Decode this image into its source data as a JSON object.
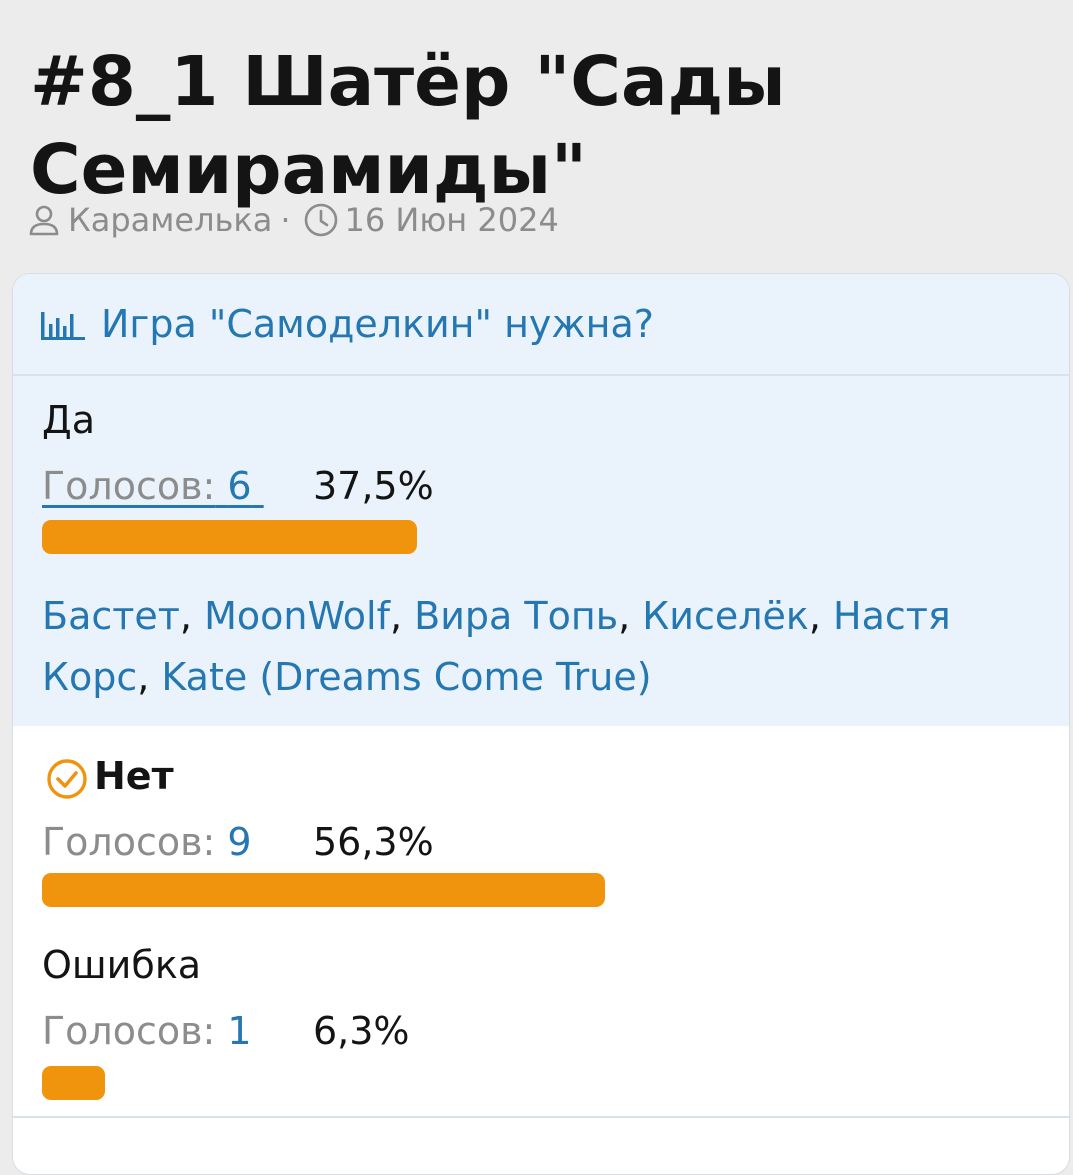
{
  "thread": {
    "title": "#8_1 Шатёр \"Сады Семирамиды\"",
    "author": "Карамелька",
    "separator": "·",
    "date": "16 Июн 2024"
  },
  "poll": {
    "question": "Игра \"Самоделкин\" нужна?",
    "votes_label": "Голосов:",
    "responses": [
      {
        "label": "Да",
        "votes": "6",
        "percent_text": "37,5%",
        "percent": 37.5,
        "voters": [
          "Бастет",
          "MoonWolf",
          "Вира Топь",
          "Киселёк",
          "Настя Корс",
          "Kate (Dreams Come True)"
        ]
      },
      {
        "label": "Нет",
        "selected": true,
        "votes": "9",
        "percent_text": "56,3%",
        "percent": 56.3
      },
      {
        "label": "Ошибка",
        "votes": "1",
        "percent_text": "6,3%",
        "percent": 6.3
      }
    ]
  },
  "colors": {
    "accent_blue": "#2577b1",
    "bar_orange": "#f0940e",
    "highlight_bg": "#eaf3fb",
    "muted_text": "#8c8c8c"
  },
  "icons": {
    "author": "user-icon",
    "date": "clock-icon",
    "poll": "bar-chart-icon",
    "selected": "check-circle-icon"
  }
}
